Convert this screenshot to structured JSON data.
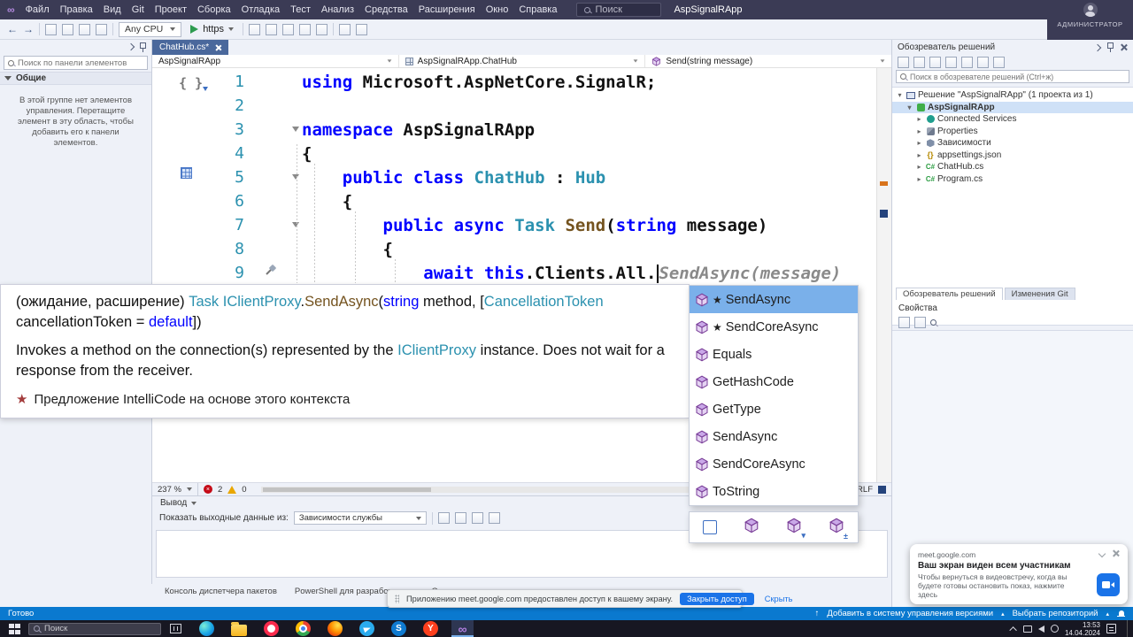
{
  "colors": {
    "titlebar": "#3b3b55",
    "toolbar_bg": "#eef1f8",
    "statusbar": "#0a79cf",
    "taskbar": "#171722",
    "keyword": "#0000ff",
    "type_name": "#2b91af",
    "method_name": "#74531f",
    "ghost_text": "#8a8a8a",
    "line_number": "#2b91af",
    "selection_blue": "#7ab0ea",
    "error_red": "#c50b17",
    "accent_blue": "#1a73e8",
    "tab_blue": "#4a689c"
  },
  "titlebar": {
    "menus": [
      "Файл",
      "Правка",
      "Вид",
      "Git",
      "Проект",
      "Сборка",
      "Отладка",
      "Тест",
      "Анализ",
      "Средства",
      "Расширения",
      "Окно",
      "Справка"
    ],
    "search": "Поиск",
    "solution": "AspSignalRApp",
    "admin": "АДМИНИСТРАТОР"
  },
  "toolbar": {
    "config": "Any CPU",
    "run": "https"
  },
  "toolbox": {
    "search_placeholder": "Поиск по панели элементов",
    "section": "Общие",
    "empty_hint": "В этой группе нет элементов управления. Перетащите элемент в эту область, чтобы добавить его к панели элементов."
  },
  "editor": {
    "tab": "ChatHub.cs*",
    "breadcrumbs": [
      "AspSignalRApp",
      "AspSignalRApp.ChatHub",
      "Send(string message)"
    ],
    "zoom": "237 %",
    "errors": "2",
    "warnings": "0",
    "eol": "CRLF",
    "code": [
      {
        "n": "1",
        "t": [
          [
            "k",
            "using"
          ],
          [
            "p",
            " Microsoft.AspNetCore.SignalR;"
          ]
        ]
      },
      {
        "n": "2",
        "t": []
      },
      {
        "n": "3",
        "fold": true,
        "t": [
          [
            "k",
            "namespace"
          ],
          [
            "p",
            " AspSignalRApp"
          ]
        ]
      },
      {
        "n": "4",
        "t": [
          [
            "p",
            "{"
          ]
        ]
      },
      {
        "n": "5",
        "fold": true,
        "t": [
          [
            "p",
            "    "
          ],
          [
            "k",
            "public"
          ],
          [
            "p",
            " "
          ],
          [
            "k",
            "class"
          ],
          [
            "p",
            " "
          ],
          [
            "c",
            "ChatHub"
          ],
          [
            "p",
            " : "
          ],
          [
            "c",
            "Hub"
          ]
        ]
      },
      {
        "n": "6",
        "t": [
          [
            "p",
            "    {"
          ]
        ]
      },
      {
        "n": "7",
        "fold": true,
        "t": [
          [
            "p",
            "        "
          ],
          [
            "k",
            "public"
          ],
          [
            "p",
            " "
          ],
          [
            "k",
            "async"
          ],
          [
            "p",
            " "
          ],
          [
            "c",
            "Task"
          ],
          [
            "p",
            " "
          ],
          [
            "m",
            "Send"
          ],
          [
            "p",
            "("
          ],
          [
            "k",
            "string"
          ],
          [
            "p",
            " message)"
          ]
        ]
      },
      {
        "n": "8",
        "t": [
          [
            "p",
            "        {"
          ]
        ]
      },
      {
        "n": "9",
        "t": [
          [
            "p",
            "            "
          ],
          [
            "k",
            "await"
          ],
          [
            "p",
            " "
          ],
          [
            "k",
            "this"
          ],
          [
            "p",
            ".Clients.All."
          ],
          [
            "caret",
            ""
          ],
          [
            "g",
            "SendAsync(message)"
          ]
        ]
      }
    ]
  },
  "tooltip": {
    "signature": [
      [
        "p",
        "(ожидание, расширение) "
      ],
      [
        "c",
        "Task"
      ],
      [
        "p",
        " "
      ],
      [
        "c",
        "IClientProxy"
      ],
      [
        "p",
        "."
      ],
      [
        "m",
        "SendAsync"
      ],
      [
        "p",
        "("
      ],
      [
        "k",
        "string"
      ],
      [
        "p",
        " method, ["
      ],
      [
        "c",
        "CancellationToken"
      ],
      [
        "p",
        " cancellationToken = "
      ],
      [
        "k",
        "default"
      ],
      [
        "p",
        "])"
      ]
    ],
    "description": [
      [
        "p",
        "Invokes a method on the connection(s) represented by the "
      ],
      [
        "c",
        "IClientProxy"
      ],
      [
        "p",
        " instance. Does not wait for a response from the receiver."
      ]
    ],
    "intellicode": "Предложение IntelliCode на основе этого контекста"
  },
  "completion": {
    "items": [
      {
        "label": "SendAsync",
        "star": true,
        "selected": true
      },
      {
        "label": "SendCoreAsync",
        "star": true
      },
      {
        "label": "Equals"
      },
      {
        "label": "GetHashCode"
      },
      {
        "label": "GetType"
      },
      {
        "label": "SendAsync"
      },
      {
        "label": "SendCoreAsync"
      },
      {
        "label": "ToString"
      }
    ]
  },
  "solution_explorer": {
    "title": "Обозреватель решений",
    "search_placeholder": "Поиск в обозревателе решений (Ctrl+ж)",
    "tree": [
      {
        "label": "Решение \"AspSignalRApp\" (1 проекта из 1)",
        "icon": "solution",
        "expanded": true,
        "level": 0
      },
      {
        "label": "AspSignalRApp",
        "icon": "project",
        "expanded": true,
        "level": 1,
        "selected": true
      },
      {
        "label": "Connected Services",
        "icon": "services",
        "arrow": true,
        "level": 2
      },
      {
        "label": "Properties",
        "icon": "properties",
        "arrow": true,
        "level": 2
      },
      {
        "label": "Зависимости",
        "icon": "dependencies",
        "arrow": true,
        "level": 2
      },
      {
        "label": "appsettings.json",
        "icon": "json",
        "arrow": true,
        "level": 2
      },
      {
        "label": "ChatHub.cs",
        "icon": "cs",
        "arrow": true,
        "level": 2
      },
      {
        "label": "Program.cs",
        "icon": "cs",
        "arrow": true,
        "level": 2
      }
    ],
    "tabs": [
      "Обозреватель решений",
      "Изменения Git"
    ]
  },
  "properties_panel": {
    "title": "Свойства"
  },
  "output": {
    "title": "Вывод",
    "show_label": "Показать выходные данные из:",
    "source": "Зависимости службы"
  },
  "bottom_tabs": [
    "Консоль диспетчера пакетов",
    "PowerShell для разработчиков",
    "Опера..."
  ],
  "share_bar": {
    "message": "Приложению meet.google.com предоставлен доступ к вашему экрану.",
    "stop": "Закрыть доступ",
    "hide": "Скрыть"
  },
  "status_bar": {
    "ready": "Готово",
    "add_scc": "Добавить в систему управления версиями",
    "select_repo": "Выбрать репозиторий"
  },
  "meet_card": {
    "domain": "meet.google.com",
    "title": "Ваш экран виден всем участникам",
    "body": "Чтобы вернуться в видеовстречу, когда вы будете готовы остановить показ, нажмите здесь"
  },
  "taskbar": {
    "search_placeholder": "Поиск",
    "time": "13:53",
    "date": "14.04.2024",
    "apps": [
      {
        "id": "edge"
      },
      {
        "id": "explorer"
      },
      {
        "id": "opera"
      },
      {
        "id": "chrome"
      },
      {
        "id": "firefox"
      },
      {
        "id": "telegram"
      },
      {
        "id": "skype"
      },
      {
        "id": "yandex"
      },
      {
        "id": "visual-studio",
        "active": true
      }
    ]
  }
}
